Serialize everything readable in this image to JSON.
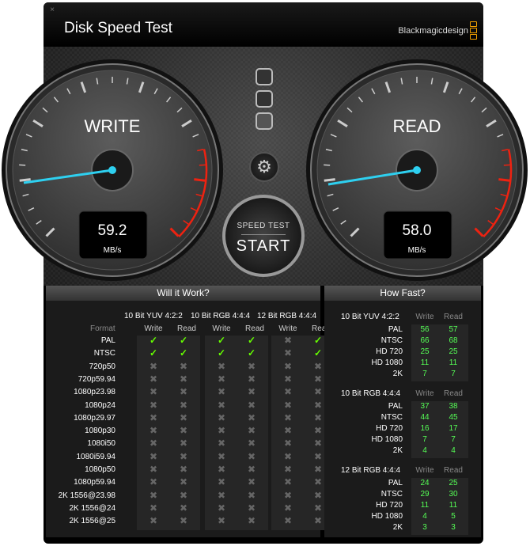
{
  "window": {
    "title": "Disk Speed Test",
    "brand": "Blackmagicdesign",
    "close_label": "×"
  },
  "gauges": {
    "write": {
      "label": "WRITE",
      "value": "59.2",
      "unit": "MB/s"
    },
    "read": {
      "label": "READ",
      "value": "58.0",
      "unit": "MB/s"
    }
  },
  "controls": {
    "start_top": "SPEED TEST",
    "start_main": "START"
  },
  "will_it_work": {
    "title": "Will it Work?",
    "format_label": "Format",
    "groups": [
      "10 Bit YUV 4:2:2",
      "10 Bit RGB 4:4:4",
      "12 Bit RGB 4:4:4"
    ],
    "write_label": "Write",
    "read_label": "Read",
    "rows": [
      {
        "format": "PAL",
        "status": [
          1,
          1,
          1,
          1,
          0,
          1
        ]
      },
      {
        "format": "NTSC",
        "status": [
          1,
          1,
          1,
          1,
          0,
          1
        ]
      },
      {
        "format": "720p50",
        "status": [
          0,
          0,
          0,
          0,
          0,
          0
        ]
      },
      {
        "format": "720p59.94",
        "status": [
          0,
          0,
          0,
          0,
          0,
          0
        ]
      },
      {
        "format": "1080p23.98",
        "status": [
          0,
          0,
          0,
          0,
          0,
          0
        ]
      },
      {
        "format": "1080p24",
        "status": [
          0,
          0,
          0,
          0,
          0,
          0
        ]
      },
      {
        "format": "1080p29.97",
        "status": [
          0,
          0,
          0,
          0,
          0,
          0
        ]
      },
      {
        "format": "1080p30",
        "status": [
          0,
          0,
          0,
          0,
          0,
          0
        ]
      },
      {
        "format": "1080i50",
        "status": [
          0,
          0,
          0,
          0,
          0,
          0
        ]
      },
      {
        "format": "1080i59.94",
        "status": [
          0,
          0,
          0,
          0,
          0,
          0
        ]
      },
      {
        "format": "1080p50",
        "status": [
          0,
          0,
          0,
          0,
          0,
          0
        ]
      },
      {
        "format": "1080p59.94",
        "status": [
          0,
          0,
          0,
          0,
          0,
          0
        ]
      },
      {
        "format": "2K 1556@23.98",
        "status": [
          0,
          0,
          0,
          0,
          0,
          0
        ]
      },
      {
        "format": "2K 1556@24",
        "status": [
          0,
          0,
          0,
          0,
          0,
          0
        ]
      },
      {
        "format": "2K 1556@25",
        "status": [
          0,
          0,
          0,
          0,
          0,
          0
        ]
      }
    ]
  },
  "how_fast": {
    "title": "How Fast?",
    "write_label": "Write",
    "read_label": "Read",
    "sections": [
      {
        "name": "10 Bit YUV 4:2:2",
        "rows": [
          [
            "PAL",
            "56",
            "57"
          ],
          [
            "NTSC",
            "66",
            "68"
          ],
          [
            "HD 720",
            "25",
            "25"
          ],
          [
            "HD 1080",
            "11",
            "11"
          ],
          [
            "2K",
            "7",
            "7"
          ]
        ]
      },
      {
        "name": "10 Bit RGB 4:4:4",
        "rows": [
          [
            "PAL",
            "37",
            "38"
          ],
          [
            "NTSC",
            "44",
            "45"
          ],
          [
            "HD 720",
            "16",
            "17"
          ],
          [
            "HD 1080",
            "7",
            "7"
          ],
          [
            "2K",
            "4",
            "4"
          ]
        ]
      },
      {
        "name": "12 Bit RGB 4:4:4",
        "rows": [
          [
            "PAL",
            "24",
            "25"
          ],
          [
            "NTSC",
            "29",
            "30"
          ],
          [
            "HD 720",
            "11",
            "11"
          ],
          [
            "HD 1080",
            "4",
            "5"
          ],
          [
            "2K",
            "3",
            "3"
          ]
        ]
      }
    ]
  },
  "symbols": {
    "check": "✓",
    "cross": "✖",
    "gear": "⚙"
  }
}
